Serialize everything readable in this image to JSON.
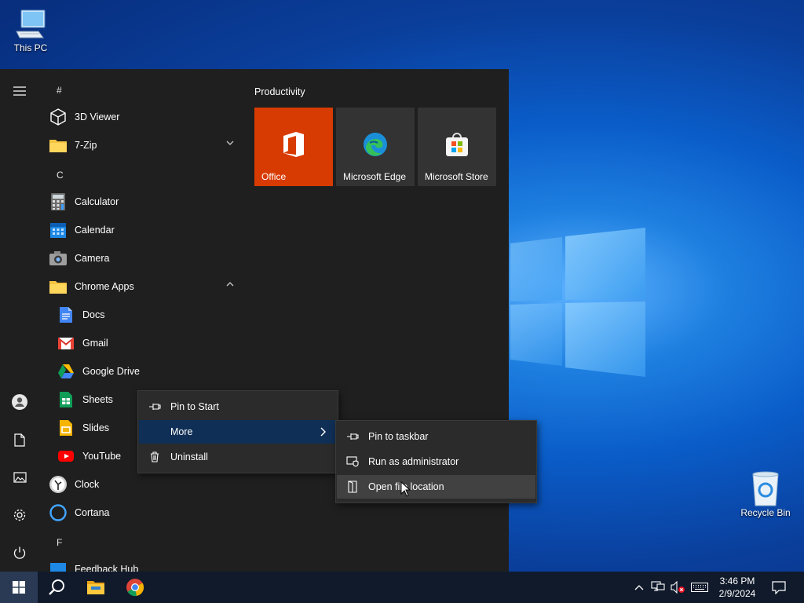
{
  "desktop": {
    "this_pc": "This PC",
    "recycle_bin": "Recycle Bin"
  },
  "start_menu": {
    "letters": {
      "hash": "#",
      "c": "C",
      "f": "F"
    },
    "apps": {
      "viewer3d": "3D Viewer",
      "zip": "7-Zip",
      "calculator": "Calculator",
      "calendar": "Calendar",
      "camera": "Camera",
      "chrome_apps": "Chrome Apps",
      "docs": "Docs",
      "gmail": "Gmail",
      "drive": "Google Drive",
      "sheets": "Sheets",
      "slides": "Slides",
      "youtube": "YouTube",
      "clock": "Clock",
      "cortana": "Cortana",
      "feedback": "Feedback Hub"
    },
    "productivity": {
      "title": "Productivity",
      "tiles": [
        "Office",
        "Microsoft Edge",
        "Microsoft Store"
      ]
    }
  },
  "context_menu": {
    "pin_to_start": "Pin to Start",
    "more": "More",
    "uninstall": "Uninstall"
  },
  "more_menu": {
    "pin_to_taskbar": "Pin to taskbar",
    "run_as_admin": "Run as administrator",
    "open_file_location": "Open file location"
  },
  "taskbar": {
    "time": "3:46 PM",
    "date": "2/9/2024"
  },
  "colors": {
    "office_tile": "#d83b01",
    "menu_highlight": "#0f2f56",
    "taskbar": "#101a2b",
    "start_bg": "#1f1f1f"
  }
}
